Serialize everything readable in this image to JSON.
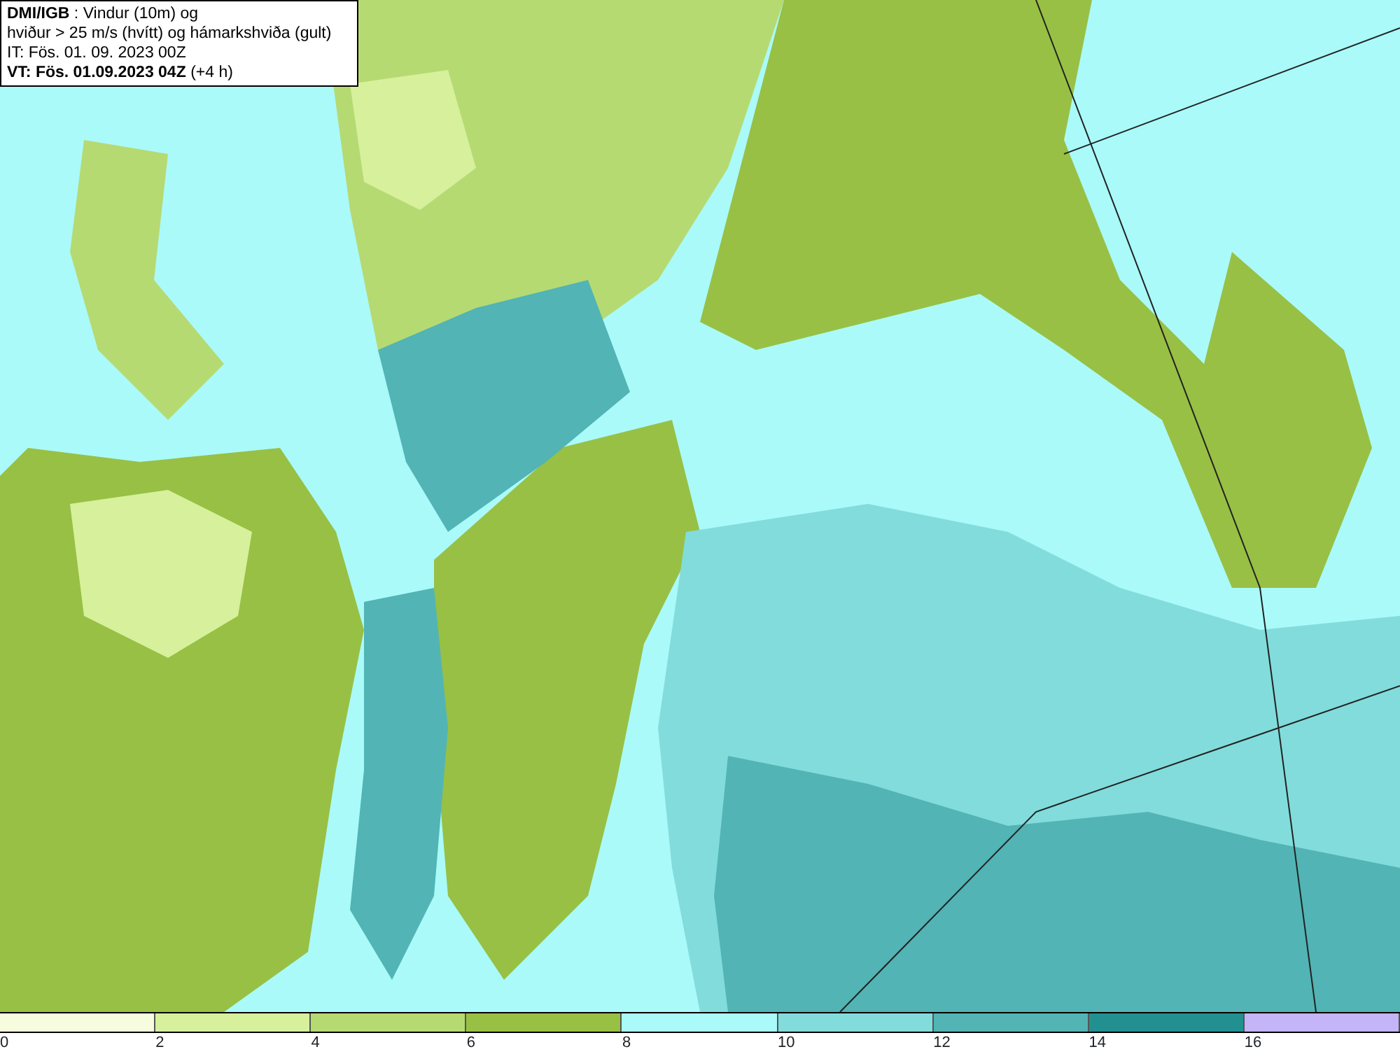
{
  "header": {
    "source": "DMI/IGB",
    "title": " : Vindur (10m) og",
    "subtitle": "hviður > 25 m/s (hvítt) og hámarkshviða (gult)",
    "issue_time": "IT: Fös. 01. 09. 2023 00Z",
    "valid_time": "VT: Fös. 01.09.2023 04Z",
    "offset": "(+4 h)"
  },
  "legend": [
    {
      "label": "0",
      "color": "#f6fcde"
    },
    {
      "label": "2",
      "color": "#d6f09c"
    },
    {
      "label": "4",
      "color": "#b6da72"
    },
    {
      "label": "6",
      "color": "#98c044"
    },
    {
      "label": "8",
      "color": "#aafafa"
    },
    {
      "label": "10",
      "color": "#82dcdc"
    },
    {
      "label": "12",
      "color": "#52b4b4"
    },
    {
      "label": "14",
      "color": "#229090"
    },
    {
      "label": "16",
      "color": "#c4b4f8"
    }
  ]
}
